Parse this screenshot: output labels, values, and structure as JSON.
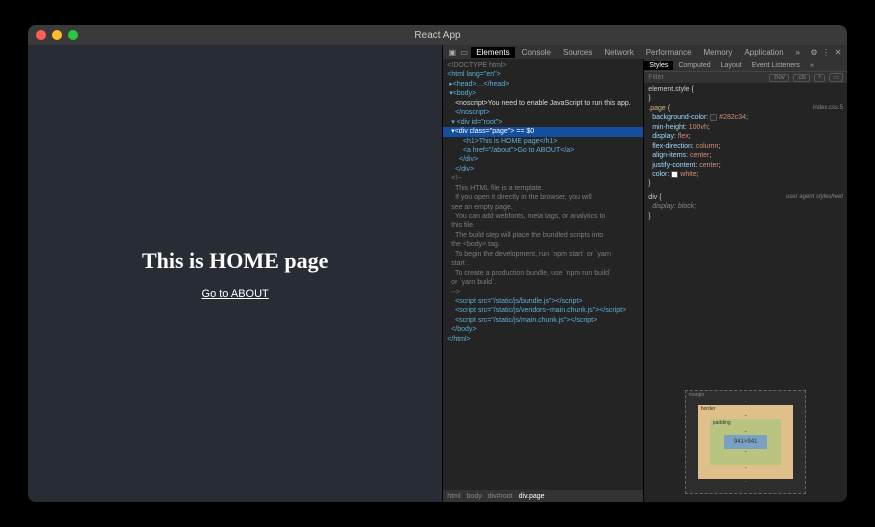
{
  "window": {
    "title": "React App"
  },
  "page": {
    "heading": "This is HOME page",
    "link_text": "Go to ABOUT",
    "link_href": "/about"
  },
  "devtools": {
    "main_tabs": [
      "Elements",
      "Console",
      "Sources",
      "Network",
      "Performance",
      "Memory",
      "Application"
    ],
    "active_tab": "Elements",
    "overflow": "»",
    "styles_tabs": [
      "Styles",
      "Computed",
      "Layout",
      "Event Listeners"
    ],
    "active_styles_tab": "Styles",
    "styles_overflow": "»",
    "filter_placeholder": "Filter",
    "filter_pills": [
      ":hov",
      ".cls",
      "+"
    ],
    "breadcrumb": [
      "html",
      "body",
      "div#root",
      "div.page"
    ],
    "dom": {
      "l0": "<!DOCTYPE html>",
      "l1_open": "<html lang=\"en\">",
      "l2": "▸<head>…</head>",
      "l3": "▾<body>",
      "l4": "  <noscript>You need to enable JavaScript to run this app.",
      "l5": "  </noscript>",
      "l6": "▾ <div id=\"root\">",
      "l7": "  ▾<div class=\"page\"> == $0",
      "l8": "    <h1>This is HOME page</h1>",
      "l9": "    <a href=\"/about\">Go to ABOUT</a>",
      "l10": "   </div>",
      "l11": "  </div>",
      "l12_c1": "  <!--",
      "l12_c2": "    This HTML file is a template.",
      "l12_c3": "    If you open it directly in the browser, you will",
      "l12_c3b": "  see an empty page.",
      "l12_c4": "",
      "l12_c5": "    You can add webfonts, meta tags, or analytics to",
      "l12_c5b": "  this file.",
      "l12_c6": "    The build step will place the bundled scripts into",
      "l12_c6b": "  the <body> tag.",
      "l12_c7": "",
      "l12_c8": "    To begin the development, run `npm start` or `yarn",
      "l12_c8b": "  start`.",
      "l12_c9": "    To create a production bundle, use `npm run build`",
      "l12_c9b": "  or `yarn build`.",
      "l12_c10": "  -->",
      "l13": "  <script src=\"/static/js/bundle.js\"></script>",
      "l14": "  <script src=\"/static/js/vendors~main.chunk.js\"></script>",
      "l15": "  <script src=\"/static/js/main.chunk.js\"></script>",
      "l16": " </body>",
      "l17": "</html>"
    },
    "styles": {
      "element_style": "element.style {",
      "element_style_close": "}",
      "rule_selector": ".page {",
      "rule_source": "index.css:5",
      "props": {
        "bg": {
          "k": "background-color",
          "v": "#282c34",
          "hex": "#282c34"
        },
        "mh": {
          "k": "min-height",
          "v": "100vh"
        },
        "disp": {
          "k": "display",
          "v": "flex"
        },
        "fd": {
          "k": "flex-direction",
          "v": "column"
        },
        "ai": {
          "k": "align-items",
          "v": "center"
        },
        "jc": {
          "k": "justify-content",
          "v": "center"
        },
        "col": {
          "k": "color",
          "v": "white",
          "hex": "#ffffff"
        }
      },
      "rule_close": "}",
      "ua_selector": "div {",
      "ua_source": "user agent stylesheet",
      "ua_prop": {
        "k": "display",
        "v": "block"
      },
      "ua_close": "}"
    },
    "box_model": {
      "margin_label": "margin",
      "border_label": "border",
      "padding_label": "padding",
      "content": "941×941",
      "dash": "-"
    }
  }
}
